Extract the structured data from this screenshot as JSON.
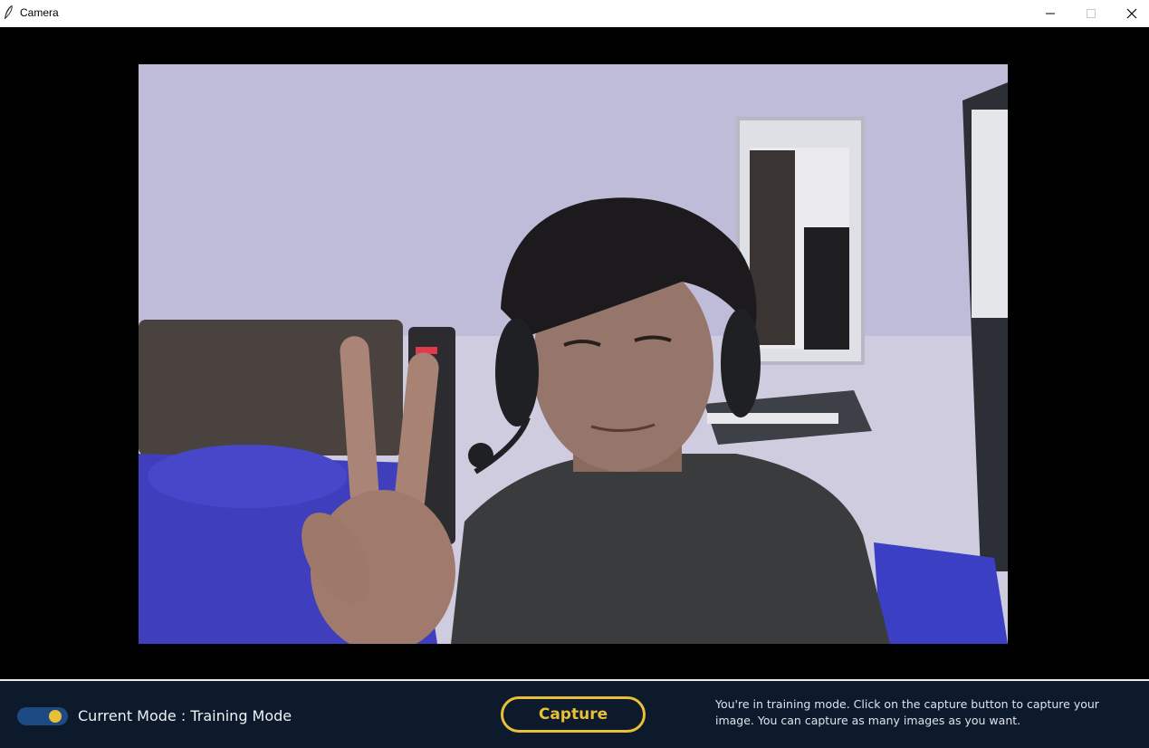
{
  "window": {
    "title": "Camera",
    "app_icon": "feather-icon",
    "controls": [
      "minimize-icon",
      "maximize-icon",
      "close-icon"
    ]
  },
  "camera": {
    "feed_description_icon": "camera-feed"
  },
  "bottom_bar": {
    "toggle_state": "on",
    "mode_label": "Current Mode : Training Mode",
    "capture_label": "Capture",
    "info_text": "You're in training mode. Click on the capture button to capture your image. You can capture as many images as you want."
  },
  "colors": {
    "bottom_bar_bg": "#0c1a2c",
    "accent": "#e7bf3a",
    "toggle_track": "#1d4a83"
  }
}
